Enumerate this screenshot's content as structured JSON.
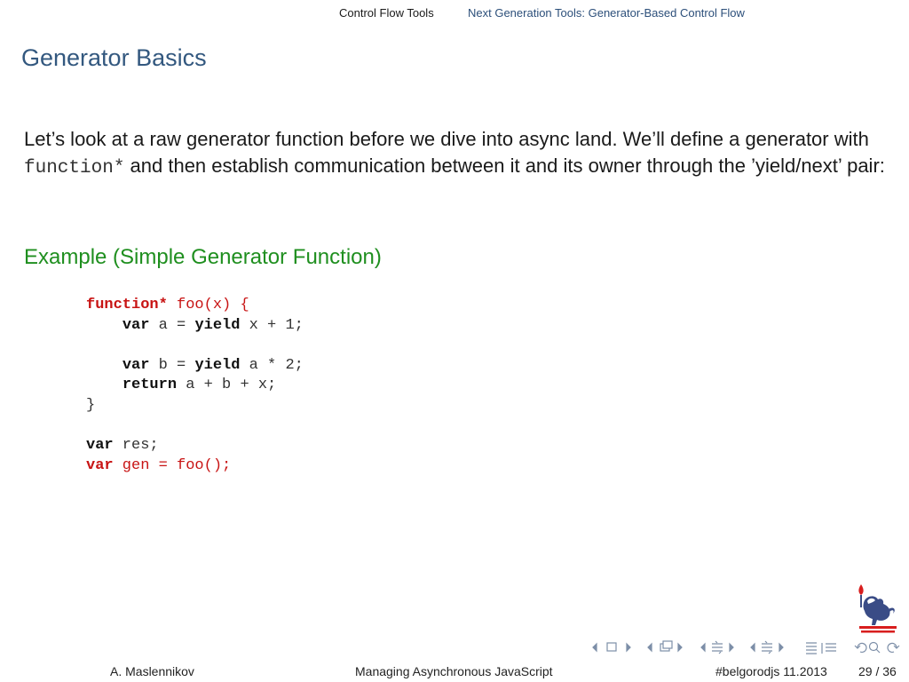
{
  "headline": {
    "section": "Control Flow Tools",
    "subsection": "Next Generation Tools: Generator-Based Control Flow"
  },
  "frame": {
    "title": "Generator Basics",
    "intro_before": "Let’s look at a raw generator function before we dive into async land. We’ll define a generator with ",
    "intro_code": "function*",
    "intro_after": " and then establish communication between it and its owner through the ’yield/next’ pair:"
  },
  "example": {
    "title": "Example (Simple Generator Function)",
    "code": {
      "l1_kw": "function*",
      "l1_rest": " foo(x) {",
      "l2_indent": "    ",
      "l2_kw1": "var",
      "l2_mid": " a = ",
      "l2_kw2": "yield",
      "l2_rest": " x + 1;",
      "l4_indent": "    ",
      "l4_kw1": "var",
      "l4_mid": " b = ",
      "l4_kw2": "yield",
      "l4_rest": " a * 2;",
      "l5_indent": "    ",
      "l5_kw": "return",
      "l5_rest": " a + b + x;",
      "l6": "}",
      "l8_kw": "var",
      "l8_rest": " res;",
      "l9_kw": "var",
      "l9_rest": " gen = foo();"
    }
  },
  "footer": {
    "author": "A. Maslennikov",
    "title": "Managing Asynchronous JavaScript",
    "event": "#belgorodjs 11.2013",
    "page": "29 / 36"
  },
  "colors": {
    "title": "#33587f",
    "example_title": "#1f8f1f",
    "highlight": "#c81414",
    "nav_icons": "#7d8fa8"
  },
  "icons": {
    "logo": "lion-torch-crest-logo",
    "nav": [
      "nav-prev-frame-icon",
      "nav-next-frame-icon",
      "nav-prev-subsection-icon",
      "nav-next-subsection-icon",
      "nav-prev-section-icon",
      "nav-next-section-icon",
      "nav-toc-icon",
      "nav-undo-icon",
      "nav-search-icon",
      "nav-redo-icon"
    ]
  }
}
